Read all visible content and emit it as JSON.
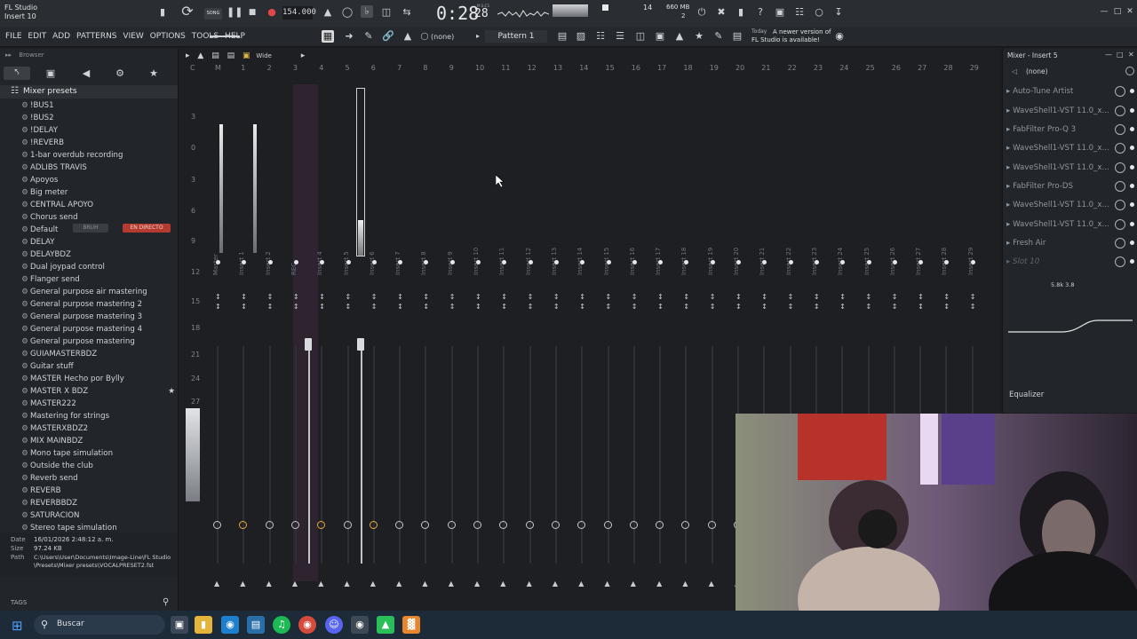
{
  "window": {
    "app_name": "FL Studio",
    "subtitle": "Insert 10"
  },
  "transport": {
    "tempo": "154.000",
    "time": "0:28",
    "time_small": "28",
    "time_unit": "M:S:CS",
    "song_mode": "SONG",
    "cpu_value": "14",
    "memory": "660 MB",
    "memory_sub": "2",
    "pattern": "Pattern 1",
    "snap": "(none)",
    "news_date": "Today",
    "news_text_1": "A newer version of",
    "news_text_2": "FL Studio is available!"
  },
  "menu": {
    "items": [
      "FILE",
      "EDIT",
      "ADD",
      "PATTERNS",
      "VIEW",
      "OPTIONS",
      "TOOLS",
      "HELP"
    ]
  },
  "browser": {
    "title": "Browser",
    "folder": "Mixer presets",
    "presets": [
      "!BUS1",
      "!BUS2",
      "!DELAY",
      "!REVERB",
      "1-bar overdub recording",
      "ADLIBS TRAVIS",
      "Apoyos",
      "Big meter",
      "CENTRAL APOYO",
      "Chorus send",
      "Default",
      "DELAY",
      "DELAYBDZ",
      "Dual joypad control",
      "Flanger send",
      "General purpose air mastering",
      "General purpose mastering 2",
      "General purpose mastering 3",
      "General purpose mastering 4",
      "General purpose mastering",
      "GUIAMASTERBDZ",
      "Guitar stuff",
      "MASTER Hecho por Bylly",
      "MASTER X BDZ",
      "MASTER222",
      "Mastering for strings",
      "MASTERXBDZ2",
      "MIX MAINBDZ",
      "Mono tape simulation",
      "Outside the club",
      "Reverb send",
      "REVERB",
      "REVERBBDZ",
      "SATURACION",
      "Stereo tape simulation"
    ],
    "overlay_badge_left": "BRUH",
    "overlay_badge_right": "EN DIRECTO",
    "info": {
      "date_label": "Date",
      "date_value": "16/01/2026 2:48:12 a. m.",
      "size_label": "Size",
      "size_value": "97.24 KB",
      "path_label": "Path",
      "path_value_1": "C:\\Users\\User\\Documents\\Image-Line\\FL Studio",
      "path_value_2": "\\Presets\\Mixer presets\\VOCALPRESET2.fst"
    },
    "tags_label": "TAGS"
  },
  "mixer": {
    "toolbar_label": "Wide",
    "ruler_numbers": [
      "C",
      "M",
      "1",
      "2",
      "3",
      "4",
      "5",
      "6",
      "7",
      "8",
      "9",
      "10",
      "11",
      "12",
      "13",
      "14",
      "15",
      "16",
      "17",
      "18",
      "19",
      "20",
      "21",
      "22",
      "23",
      "24",
      "25",
      "26",
      "27",
      "28",
      "29"
    ],
    "db_scale": [
      "3",
      "0",
      "3",
      "6",
      "9",
      "12",
      "15",
      "18",
      "21",
      "24",
      "27"
    ],
    "strips": [
      "Master",
      "Insert 1",
      "Insert 2",
      "REC",
      "Insert 4",
      "Insert 5",
      "Insert 6",
      "Insert 7",
      "Insert 8",
      "Insert 9",
      "Insert 10",
      "Insert 11",
      "Insert 12",
      "Insert 13",
      "Insert 14",
      "Insert 15",
      "Insert 16",
      "Insert 17",
      "Insert 18",
      "Insert 19",
      "Insert 20",
      "Insert 21",
      "Insert 22",
      "Insert 23",
      "Insert 24",
      "Insert 25",
      "Insert 26",
      "Insert 27",
      "Insert 28",
      "Insert 29"
    ]
  },
  "insert_panel": {
    "title": "Mixer - Insert 5",
    "input": "(none)",
    "slots": [
      "Auto-Tune Artist",
      "WaveShell1-VST 11.0_x...",
      "FabFilter Pro-Q 3",
      "WaveShell1-VST 11.0_x...",
      "WaveShell1-VST 11.0_x...",
      "FabFilter Pro-DS",
      "WaveShell1-VST 11.0_x...",
      "WaveShell1-VST 11.0_x...",
      "Fresh Air",
      "Slot 10"
    ],
    "eq_value": "5.8k 3.8",
    "eq_label": "Equalizer"
  },
  "taskbar": {
    "search_placeholder": "Buscar"
  },
  "colors": {
    "accent_orange": "#f0a93a",
    "record_red": "#e04848",
    "badge_red": "#c0392b"
  }
}
